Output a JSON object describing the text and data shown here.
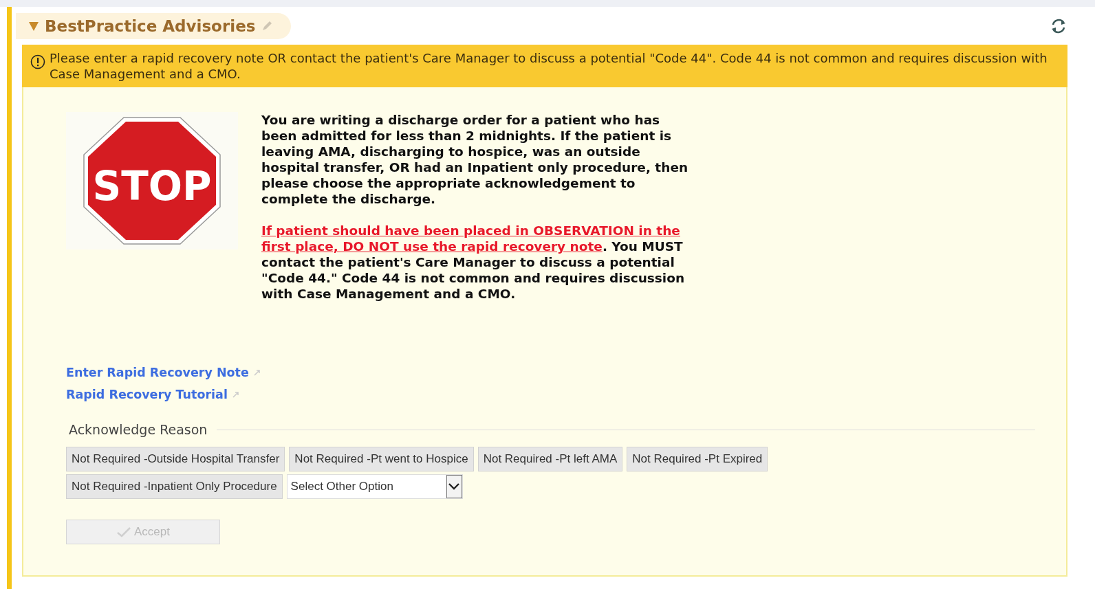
{
  "section": {
    "title": "BestPractice Advisories",
    "expanded": true
  },
  "alert": {
    "message": "Please enter a rapid recovery note OR contact the patient's Care Manager to discuss a potential \"Code 44\". Code 44 is not common and requires discussion with Case Management and a CMO."
  },
  "stop_sign": {
    "label": "STOP"
  },
  "paragraphs": [
    {
      "text": "You are writing a discharge order for a patient who has been admitted for less than 2 midnights.  If the patient is leaving AMA, discharging to hospice, was an outside hospital transfer, OR had an Inpatient only procedure, then please choose the appropriate acknowledgement to complete the discharge."
    },
    {
      "warning": "If patient should have been placed in OBSERVATION in the first place, DO NOT use the rapid recovery note",
      "text": ".  You MUST contact the patient's Care Manager to discuss a potential \"Code 44.\" Code 44 is not common and requires discussion with Case Management and a CMO."
    }
  ],
  "links": [
    "Enter Rapid Recovery Note",
    "Rapid Recovery Tutorial"
  ],
  "acknowledge": {
    "legend": "Acknowledge Reason",
    "options": [
      {
        "label": "Not Required -Outside Hospital Transfer",
        "selected": false
      },
      {
        "label": "Not Required -Pt went to Hospice",
        "selected": false
      },
      {
        "label": "Not Required -Pt left AMA",
        "selected": false
      },
      {
        "label": "Not Required -Pt Expired",
        "selected": false
      },
      {
        "label": "Not Required -Inpatient Only Procedure",
        "selected": false
      }
    ],
    "other": {
      "value": "Select Other Option"
    }
  },
  "accept": {
    "label": "Accept",
    "disabled": true
  }
}
